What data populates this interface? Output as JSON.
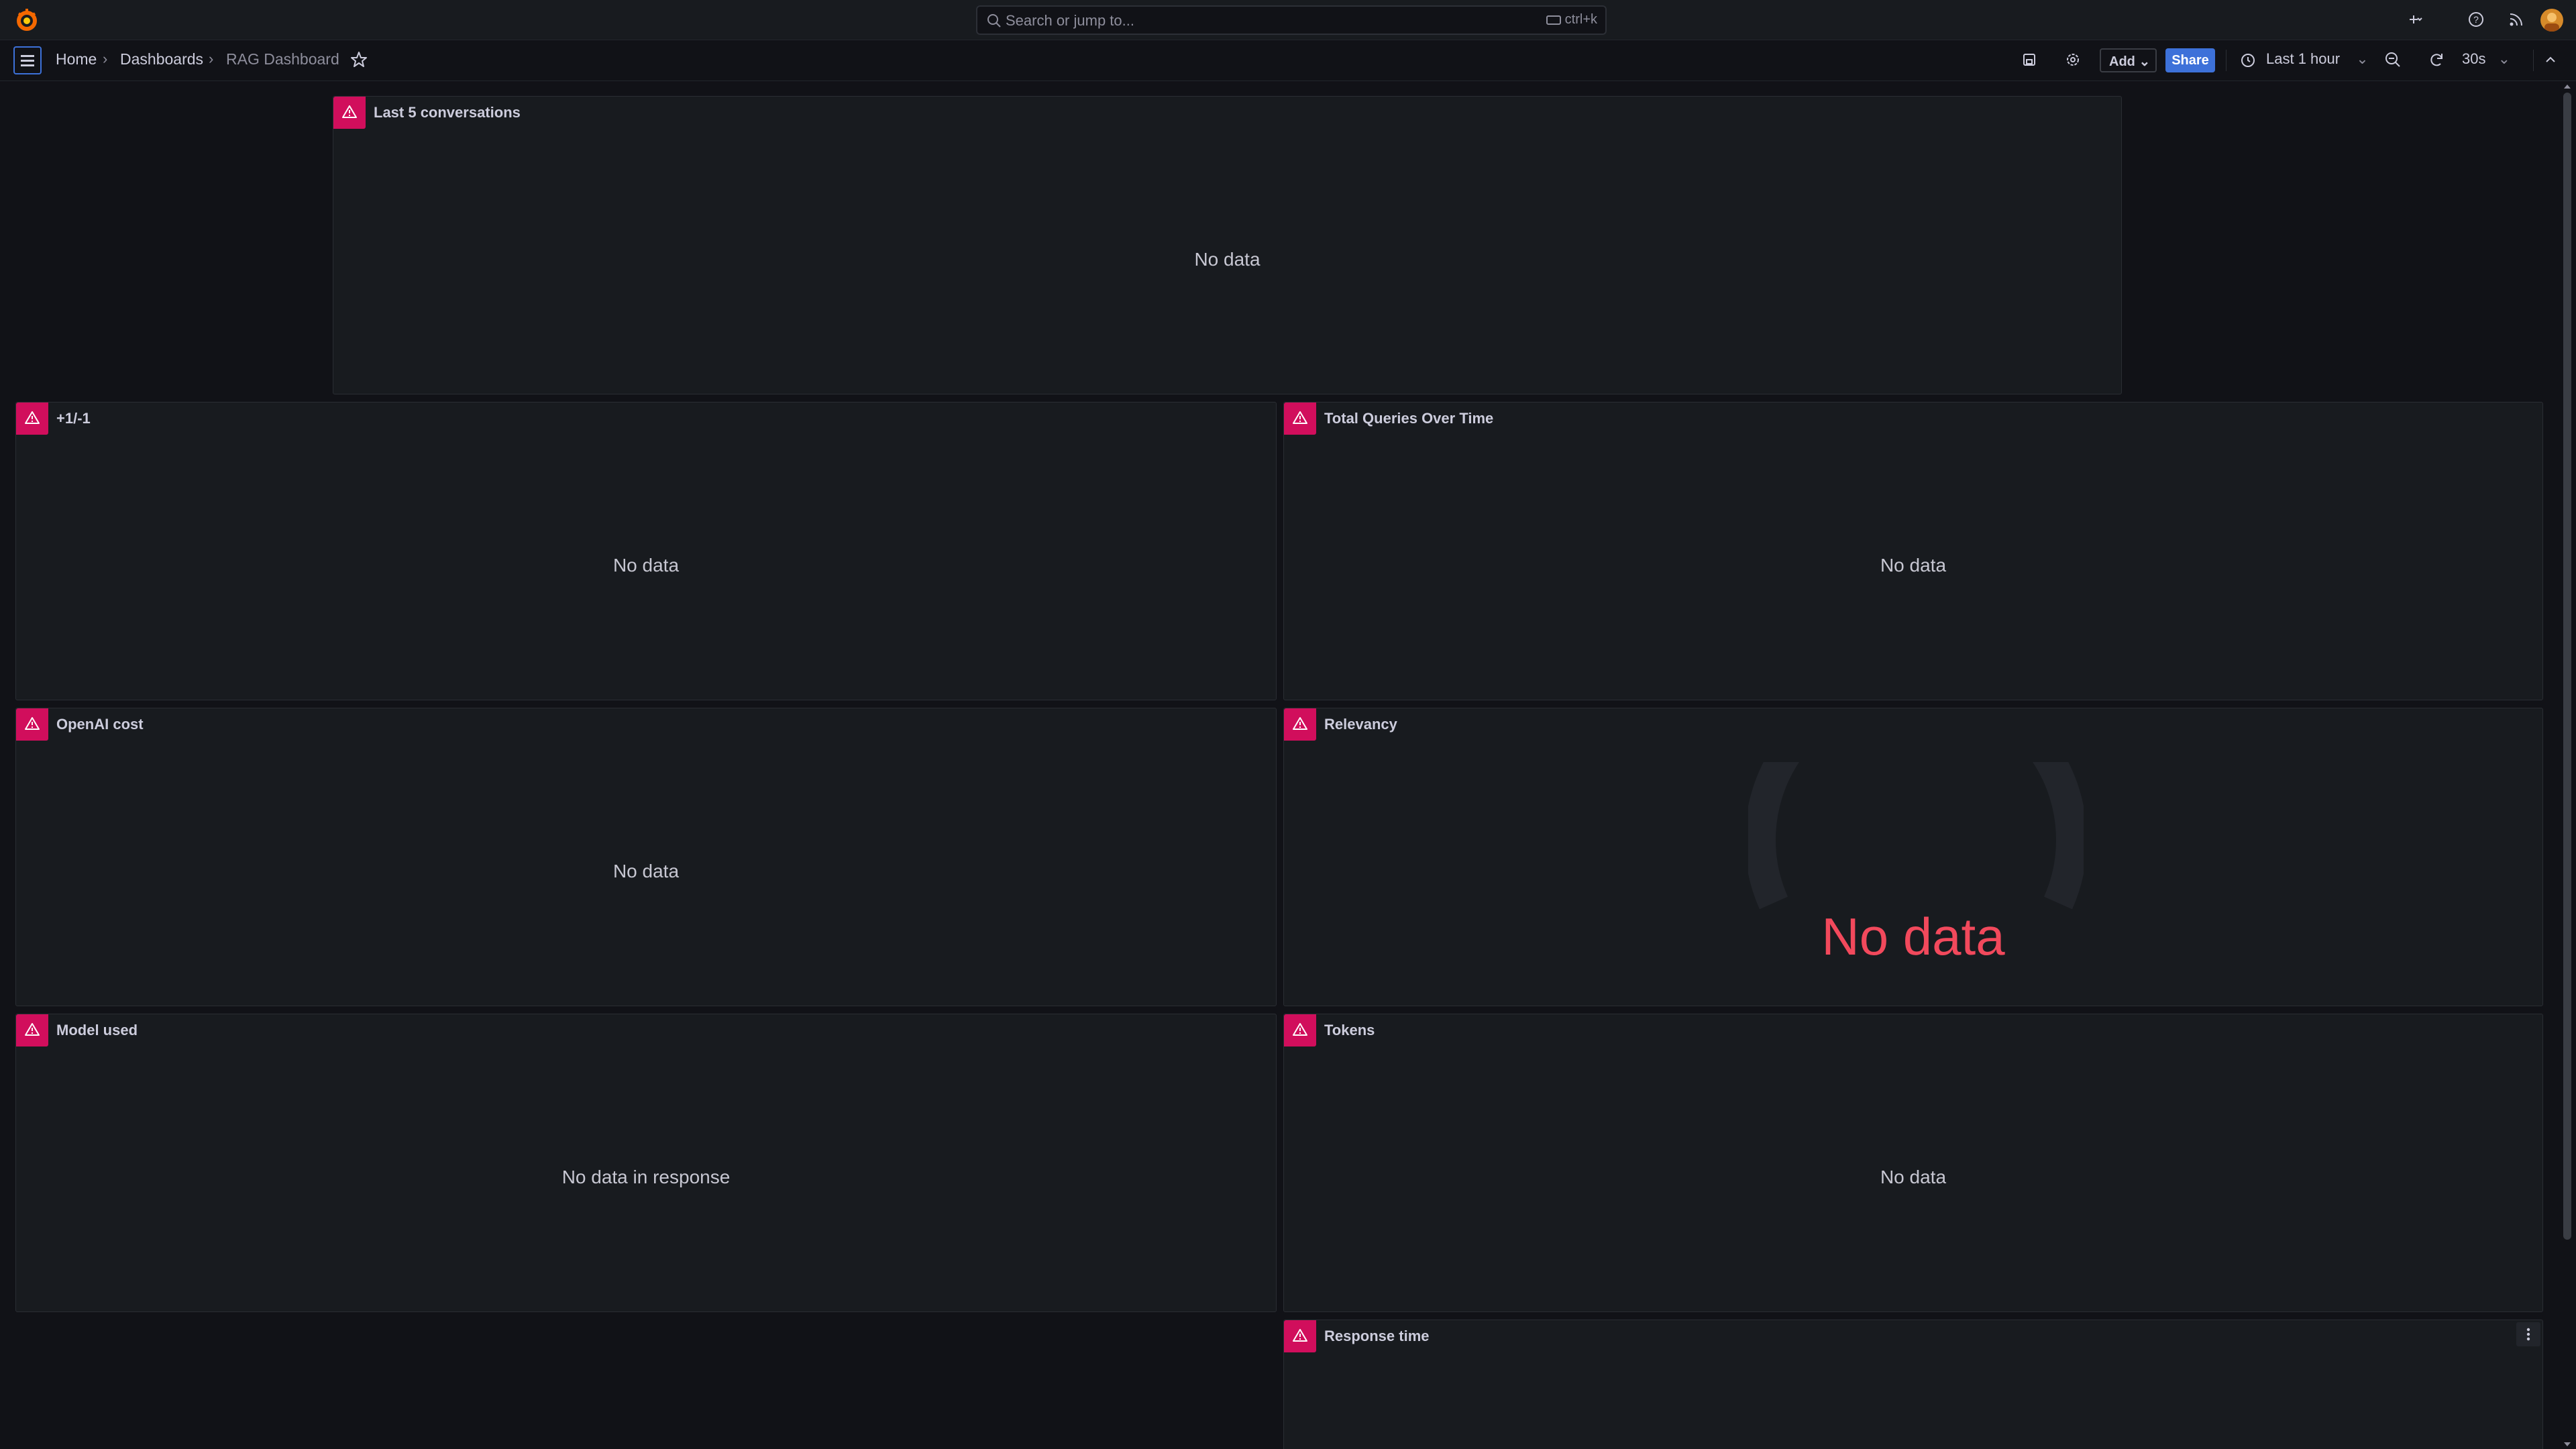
{
  "topbar": {
    "search_placeholder": "Search or jump to...",
    "search_shortcut": "ctrl+k"
  },
  "nav": {
    "breadcrumbs": [
      "Home",
      "Dashboards",
      "RAG Dashboard"
    ],
    "add_label": "Add",
    "share_label": "Share",
    "time_range": "Last 1 hour",
    "refresh_interval": "30s"
  },
  "colors": {
    "accent": "#3d71d9",
    "warning": "#d10e5c",
    "gauge_nodata": "#f2495c"
  },
  "panels": [
    {
      "title": "Last 5 conversations",
      "message": "No data"
    },
    {
      "title": "+1/-1",
      "message": "No data"
    },
    {
      "title": "Total Queries Over Time",
      "message": "No data"
    },
    {
      "title": "OpenAI cost",
      "message": "No data"
    },
    {
      "title": "Relevancy",
      "message": "No data"
    },
    {
      "title": "Model used",
      "message": "No data in response"
    },
    {
      "title": "Tokens",
      "message": "No data"
    },
    {
      "title": "Response time",
      "message": ""
    }
  ]
}
